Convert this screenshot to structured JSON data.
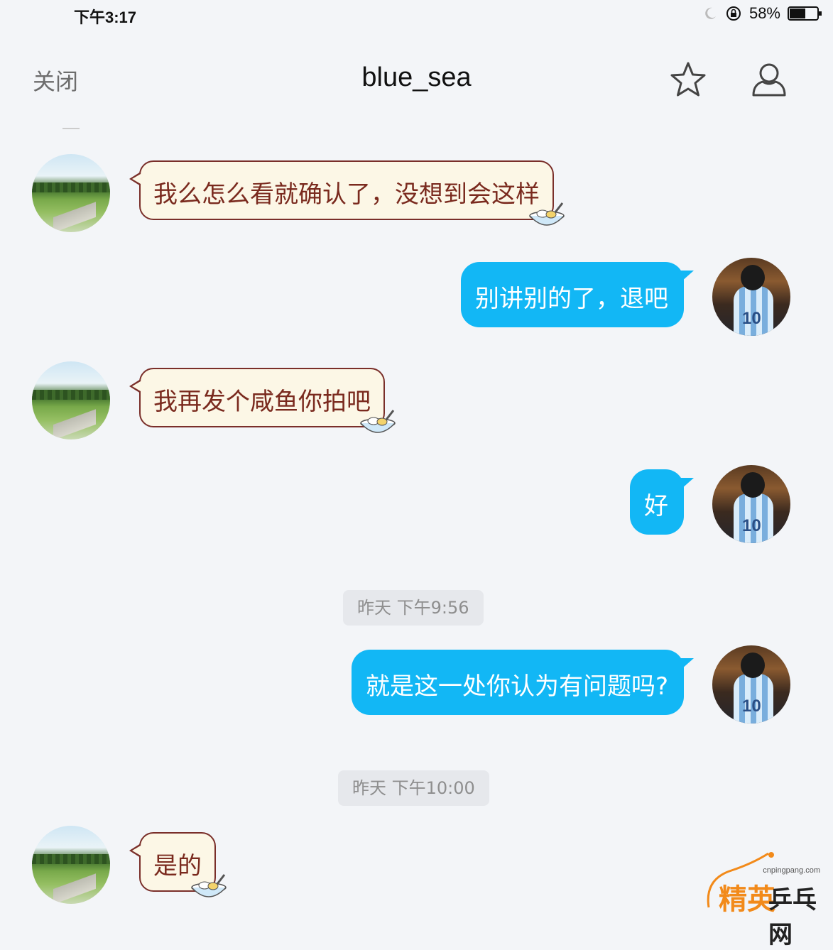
{
  "status_bar": {
    "time": "下午3:17",
    "battery_percent": "58%",
    "battery_level": 0.58
  },
  "nav": {
    "close_label": "关闭",
    "title": "blue_sea",
    "favorite_icon": "star-icon",
    "profile_icon": "person-icon"
  },
  "messages": [
    {
      "side": "in",
      "text": "我么怎么看就确认了，没想到会这样"
    },
    {
      "side": "out",
      "text": "别讲别的了，退吧"
    },
    {
      "side": "in",
      "text": "我再发个咸鱼你拍吧"
    },
    {
      "side": "out",
      "text": "好"
    },
    {
      "side": "out",
      "text": "就是这一处你认为有问题吗?"
    },
    {
      "side": "in",
      "text": "是的"
    }
  ],
  "timestamps": [
    "昨天 下午9:56",
    "昨天 下午10:00"
  ],
  "watermark": {
    "domain": "cnpingpang.com",
    "brand": "精英",
    "site": "乒乓网"
  },
  "colors": {
    "outgoing_bubble": "#12b7f5",
    "incoming_bubble": "#fcf7e6",
    "incoming_border": "#7a2f2a",
    "background": "#f3f5f8"
  }
}
